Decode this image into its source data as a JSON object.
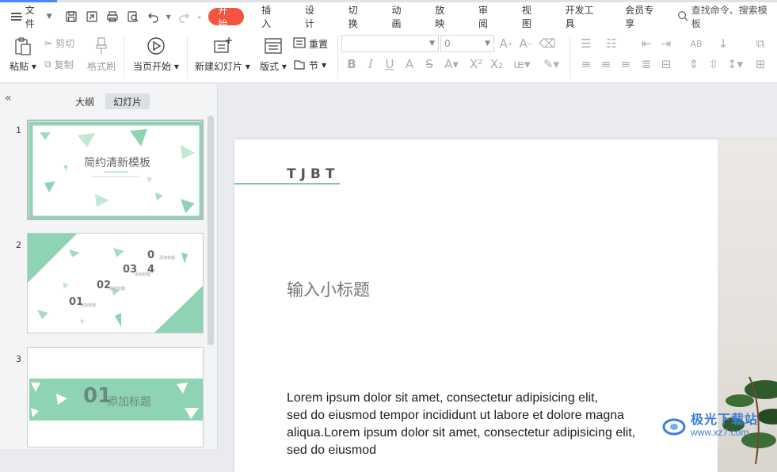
{
  "menubar": {
    "file_label": "文件",
    "tabs": [
      "开始",
      "插入",
      "设计",
      "切换",
      "动画",
      "放映",
      "审阅",
      "视图",
      "开发工具",
      "会员专享"
    ],
    "active_tab": "开始",
    "search_label": "查找命令、搜索模板"
  },
  "ribbon": {
    "paste": "粘贴",
    "cut": "剪切",
    "copy": "复制",
    "format_painter": "格式刷",
    "start_from_current": "当页开始",
    "new_slide": "新建幻灯片",
    "layout": "版式",
    "reset": "重置",
    "section": "节",
    "font_size_value": "0"
  },
  "panel": {
    "tab_outline": "大纲",
    "tab_slides": "幻灯片",
    "slides": [
      {
        "number": "1",
        "title": "简约清新模板"
      },
      {
        "number": "2",
        "items": [
          "0",
          "4",
          "03",
          "02",
          "01"
        ],
        "item_caption": "添加标题"
      },
      {
        "number": "3",
        "title_num": "01",
        "title_text": "添加标题"
      }
    ]
  },
  "slide": {
    "header": "TJBT",
    "subtitle": "输入小标题",
    "body_lines": [
      "Lorem ipsum dolor sit amet, consectetur adipisicing elit,",
      "sed do eiusmod tempor incididunt ut labore et dolore magna",
      "aliqua.Lorem ipsum dolor sit amet, consectetur adipisicing elit,",
      "sed do eiusmod"
    ]
  },
  "watermark": {
    "name": "极光下载站",
    "url": "www.xz7.com"
  },
  "colors": {
    "accent_tab": "#f2543f",
    "theme_green": "#8fd3b5",
    "link_blue": "#3a7fd5"
  }
}
